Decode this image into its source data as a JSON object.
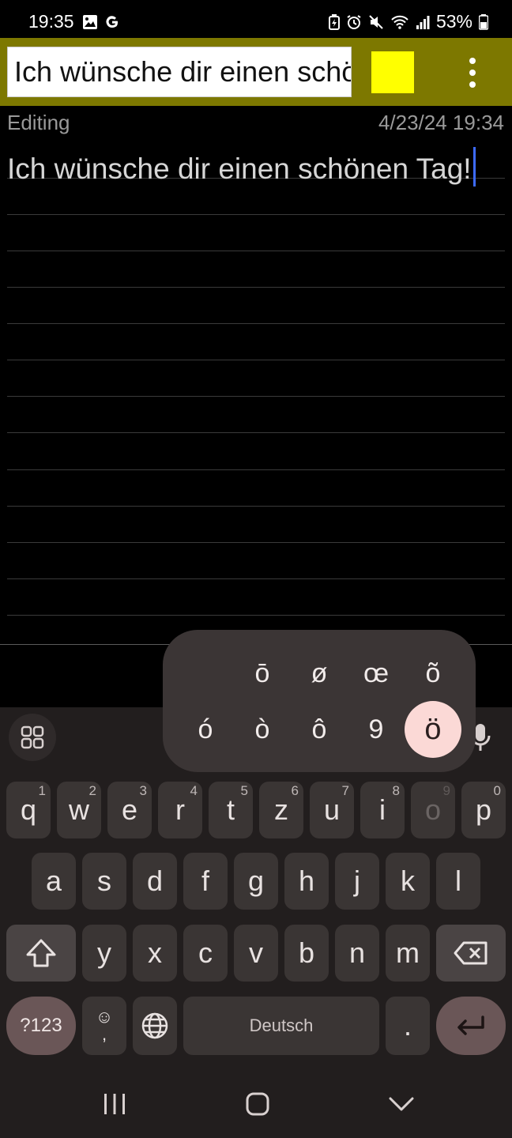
{
  "status_bar": {
    "time": "19:35",
    "battery": "53%",
    "left_icons": [
      "gallery-icon",
      "google-icon"
    ],
    "right_icons": [
      "battery-saver-icon",
      "alarm-icon",
      "mute-icon",
      "wifi-icon",
      "signal-icon",
      "battery-icon"
    ]
  },
  "title_bar": {
    "title_value": "Ich wünsche dir einen schönen Tag!",
    "color_swatch": "#ffff00",
    "accent_color": "#7d7800"
  },
  "meta": {
    "status": "Editing",
    "date": "4/23/24 19:34"
  },
  "note": {
    "text": "Ich wünsche dir einen schönen Tag!"
  },
  "accent_popup": {
    "row1": [
      "ō",
      "ø",
      "œ",
      "õ"
    ],
    "row2": [
      "ó",
      "ò",
      "ô",
      "9",
      "ö"
    ],
    "selected": "ö"
  },
  "keyboard": {
    "row1": [
      {
        "key": "q",
        "hint": "1"
      },
      {
        "key": "w",
        "hint": "2"
      },
      {
        "key": "e",
        "hint": "3"
      },
      {
        "key": "r",
        "hint": "4"
      },
      {
        "key": "t",
        "hint": "5"
      },
      {
        "key": "z",
        "hint": "6"
      },
      {
        "key": "u",
        "hint": "7"
      },
      {
        "key": "i",
        "hint": "8"
      },
      {
        "key": "o",
        "hint": "9"
      },
      {
        "key": "p",
        "hint": "0"
      }
    ],
    "row2": [
      "a",
      "s",
      "d",
      "f",
      "g",
      "h",
      "j",
      "k",
      "l"
    ],
    "row3": [
      "y",
      "x",
      "c",
      "v",
      "b",
      "n",
      "m"
    ],
    "symbols_label": "?123",
    "emoji_top": "☺",
    "emoji_bottom": ",",
    "space_label": "Deutsch",
    "period_label": "."
  },
  "nav": {
    "recents": "recents-icon",
    "home": "home-icon",
    "back": "back-icon"
  }
}
